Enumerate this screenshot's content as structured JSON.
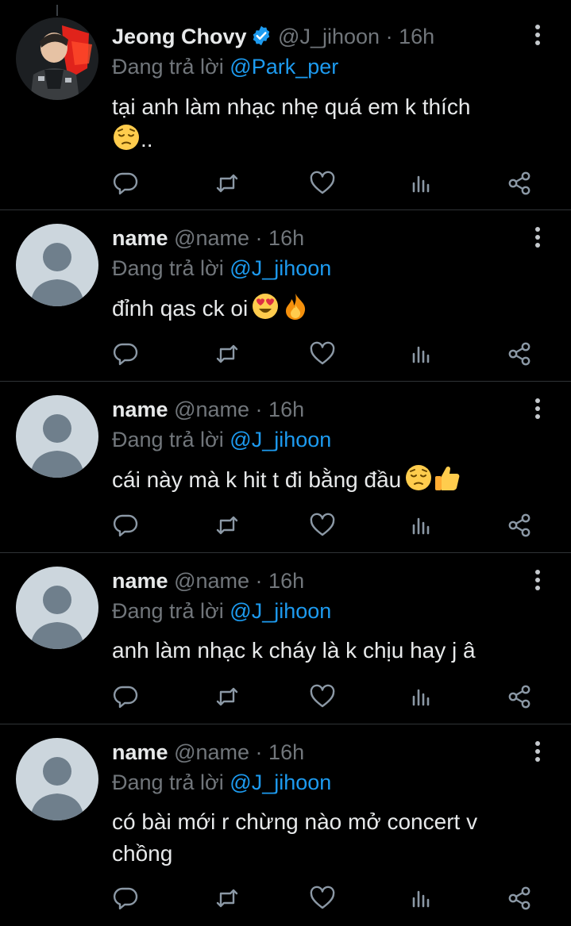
{
  "colors": {
    "background": "#000000",
    "text": "#e7e9ea",
    "muted": "#71767b",
    "mention": "#1d9bf0",
    "divider": "#2f3336",
    "verified": "#1d9bf0"
  },
  "tweets": [
    {
      "display_name": "Jeong Chovy",
      "verified": true,
      "handle": "@J_jihoon",
      "separator": "·",
      "time": "16h",
      "replying_prefix": "Đang trả lời",
      "replying_to": "@Park_per",
      "text": "tại anh làm nhạc nhẹ quá em k thích",
      "text_after_emoji": "..",
      "emojis": [
        "pensive-face-emoji"
      ]
    },
    {
      "display_name": "name",
      "verified": false,
      "handle": "@name",
      "separator": "·",
      "time": "16h",
      "replying_prefix": "Đang trả lời",
      "replying_to": "@J_jihoon",
      "text": "đỉnh qas ck oi",
      "text_after_emoji": "",
      "emojis": [
        "heart-eyes-emoji",
        "fire-emoji"
      ]
    },
    {
      "display_name": "name",
      "verified": false,
      "handle": "@name",
      "separator": "·",
      "time": "16h",
      "replying_prefix": "Đang trả lời",
      "replying_to": "@J_jihoon",
      "text": "cái này mà k hit t đi bằng đầu",
      "text_after_emoji": "",
      "emojis": [
        "pensive-face-emoji",
        "thumbs-up-emoji"
      ]
    },
    {
      "display_name": "name",
      "verified": false,
      "handle": "@name",
      "separator": "·",
      "time": "16h",
      "replying_prefix": "Đang trả lời",
      "replying_to": "@J_jihoon",
      "text": "anh làm nhạc k cháy là k chịu hay j â",
      "text_after_emoji": "",
      "emojis": []
    },
    {
      "display_name": "name",
      "verified": false,
      "handle": "@name",
      "separator": "·",
      "time": "16h",
      "replying_prefix": "Đang trả lời",
      "replying_to": "@J_jihoon",
      "text": "có bài mới r chừng nào mở concert v chồng",
      "text_after_emoji": "",
      "emojis": []
    }
  ],
  "action_icons": [
    "reply-icon",
    "retweet-icon",
    "like-icon",
    "views-icon",
    "share-icon"
  ]
}
